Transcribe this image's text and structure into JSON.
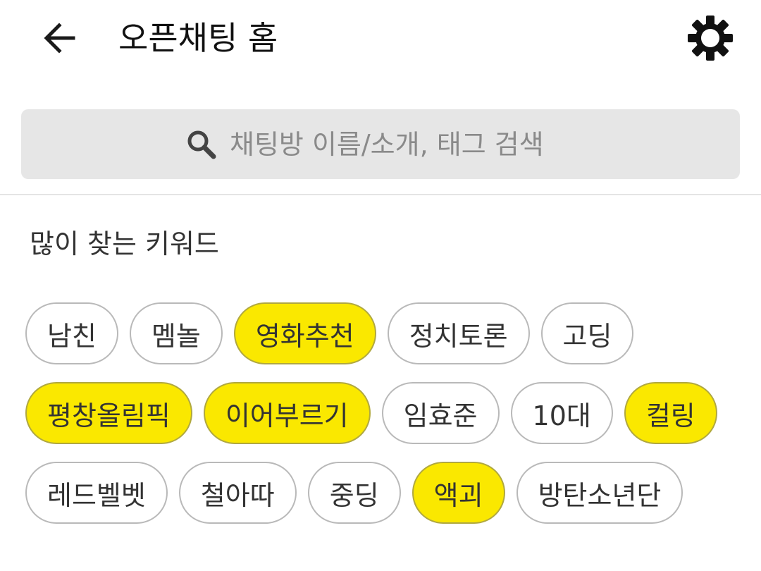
{
  "header": {
    "title": "오픈채팅 홈",
    "back_icon": "arrow-left-icon",
    "settings_icon": "gear-icon"
  },
  "search": {
    "placeholder": "채팅방 이름/소개, 태그 검색",
    "icon": "search-icon"
  },
  "keywords": {
    "title": "많이 찾는 키워드",
    "highlight_color": "#fae800",
    "chips": [
      {
        "label": "남친",
        "highlighted": false
      },
      {
        "label": "멤놀",
        "highlighted": false
      },
      {
        "label": "영화추천",
        "highlighted": true
      },
      {
        "label": "정치토론",
        "highlighted": false
      },
      {
        "label": "고딩",
        "highlighted": false
      },
      {
        "label": "평창올림픽",
        "highlighted": true
      },
      {
        "label": "이어부르기",
        "highlighted": true
      },
      {
        "label": "임효준",
        "highlighted": false
      },
      {
        "label": "10대",
        "highlighted": false
      },
      {
        "label": "컬링",
        "highlighted": true
      },
      {
        "label": "레드벨벳",
        "highlighted": false
      },
      {
        "label": "철아따",
        "highlighted": false
      },
      {
        "label": "중딩",
        "highlighted": false
      },
      {
        "label": "액괴",
        "highlighted": true
      },
      {
        "label": "방탄소년단",
        "highlighted": false
      }
    ]
  }
}
